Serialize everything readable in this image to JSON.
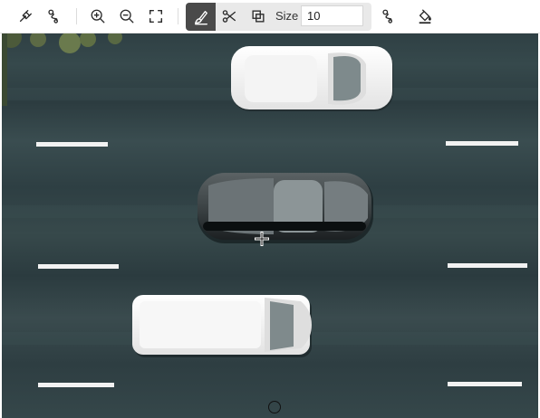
{
  "toolbar": {
    "tools": [
      {
        "name": "pen-tool",
        "icon": "pen-nib-icon"
      },
      {
        "name": "lasso-tool",
        "icon": "lasso-icon"
      },
      {
        "name": "zoom-in",
        "icon": "zoom-in-icon"
      },
      {
        "name": "zoom-out",
        "icon": "zoom-out-icon"
      },
      {
        "name": "fit-screen",
        "icon": "fullscreen-corners-icon"
      },
      {
        "name": "brush",
        "icon": "brush-icon",
        "active": true
      },
      {
        "name": "scissors",
        "icon": "scissors-icon"
      },
      {
        "name": "crop",
        "icon": "crop-icon"
      },
      {
        "name": "lasso-alt",
        "icon": "lasso-icon"
      },
      {
        "name": "fill",
        "icon": "paint-bucket-icon"
      }
    ],
    "size_label": "Size",
    "size_value": "10"
  },
  "colors": {
    "active_tool_bg": "#4a4a4a",
    "tool_group_bg": "#e9e9e9",
    "road": "#2f4044",
    "lane_marking": "#f2f2f2"
  }
}
